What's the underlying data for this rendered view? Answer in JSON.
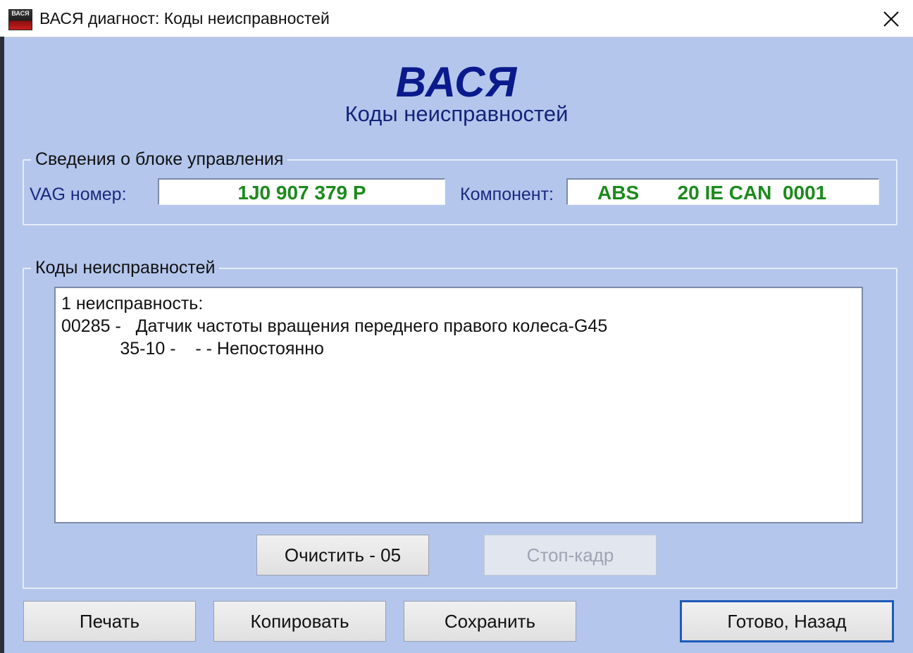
{
  "window": {
    "title": "ВАСЯ диагност: Коды неисправностей",
    "icon": "vasya-app-icon",
    "icon_text": "ВАСЯ"
  },
  "header": {
    "brand": "ВАСЯ",
    "subtitle": "Коды неисправностей"
  },
  "control_unit": {
    "legend": "Сведения о блоке управления",
    "vag_label": "VAG номер:",
    "vag_value": "1J0 907 379 P",
    "component_label": "Компонент:",
    "component_value": "ABS       20 IE CAN  0001"
  },
  "fault_codes": {
    "legend": "Коды неисправностей",
    "lines": [
      "1 неисправность:",
      "00285 -   Датчик частоты вращения переднего правого колеса-G45",
      "            35-10 -    - - Непостоянно"
    ],
    "clear_button": "Очистить - 05",
    "freeze_frame_button": "Стоп-кадр",
    "freeze_frame_enabled": false
  },
  "footer": {
    "print_button": "Печать",
    "copy_button": "Копировать",
    "save_button": "Сохранить",
    "done_button": "Готово, Назад"
  },
  "colors": {
    "background": "#b4c6ec",
    "brand": "#0a1a8c",
    "value_green": "#1c8a1c",
    "focus_border": "#1e5ab8"
  }
}
